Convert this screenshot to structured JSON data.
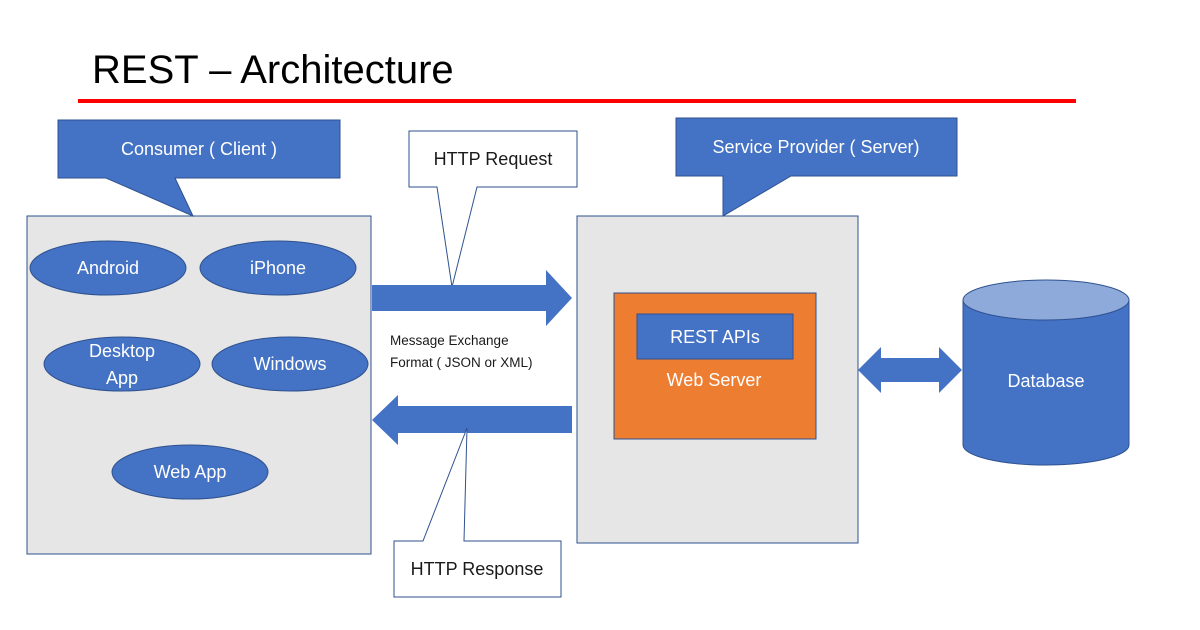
{
  "title": "REST – Architecture",
  "colors": {
    "accent_line": "#ff0000",
    "shape_blue": "#4472c4",
    "shape_blue_light": "#8eaadb",
    "outline_blue": "#2f528f",
    "container_gray": "#e7e6e6",
    "web_server_orange": "#ed7d31"
  },
  "client": {
    "callout_label": "Consumer ( Client )",
    "apps": [
      {
        "label": "Android"
      },
      {
        "label": "iPhone"
      },
      {
        "label_line1": "Desktop",
        "label_line2": "App"
      },
      {
        "label": "Windows"
      },
      {
        "label": "Web App"
      }
    ]
  },
  "exchange": {
    "request_label": "HTTP Request",
    "response_label": "HTTP Response",
    "format_line1": "Message Exchange",
    "format_line2": "Format ( JSON or XML)"
  },
  "server": {
    "callout_label": "Service Provider ( Server)",
    "web_server_label": "Web Server",
    "rest_apis_label": "REST APIs"
  },
  "database": {
    "label": "Database"
  }
}
